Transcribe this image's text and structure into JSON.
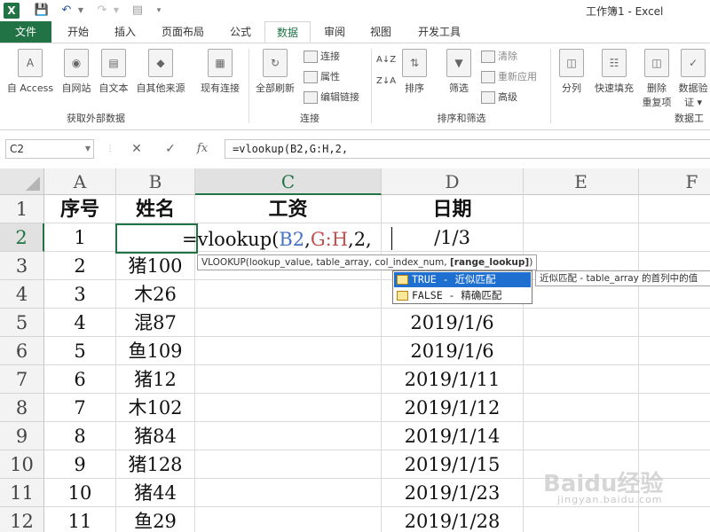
{
  "window": {
    "title": "工作簿1 - Excel"
  },
  "quick_access": {
    "logo": "X",
    "save_icon": "floppy-icon",
    "undo_icon": "undo-icon",
    "redo_icon": "redo-icon",
    "preview_icon": "print-preview-icon"
  },
  "tabs": [
    "文件",
    "开始",
    "插入",
    "页面布局",
    "公式",
    "数据",
    "审阅",
    "视图",
    "开发工具"
  ],
  "active_tab": "数据",
  "ribbon": {
    "get_external": {
      "buttons": [
        "自 Access",
        "自网站",
        "自文本",
        "自其他来源"
      ],
      "group_label": "获取外部数据"
    },
    "existing": "现有连接",
    "refresh_all": "全部刷新",
    "connections": {
      "items": [
        "连接",
        "属性",
        "编辑链接"
      ],
      "group_label": "连接"
    },
    "sort_asc": "A↓Z",
    "sort_desc": "Z↓A",
    "sort": "排序",
    "filter": "筛选",
    "filter_small": [
      "清除",
      "重新应用",
      "高级"
    ],
    "sort_filter_group": "排序和筛选",
    "split": "分列",
    "flash_fill": "快速填充",
    "remove_dup_1": "删除",
    "remove_dup_2": "重复项",
    "validate_1": "数据验",
    "validate_2": "证 ▾",
    "data_tools_group": "数据工"
  },
  "formula_bar": {
    "name_box": "C2",
    "cancel": "✕",
    "enter": "✓",
    "fx": "fx",
    "formula": "=vlookup(B2,G:H,2,"
  },
  "columns": [
    "A",
    "B",
    "C",
    "D",
    "E",
    "F"
  ],
  "rows": [
    {
      "num": "1",
      "a": "序号",
      "b": "姓名",
      "c": "工资",
      "d": "日期"
    },
    {
      "num": "2",
      "a": "1",
      "b": "",
      "c": "",
      "d": "/1/3"
    },
    {
      "num": "3",
      "a": "2",
      "b": "猪100",
      "c": "",
      "d": ""
    },
    {
      "num": "4",
      "a": "3",
      "b": "木26",
      "c": "",
      "d": ""
    },
    {
      "num": "5",
      "a": "4",
      "b": "混87",
      "c": "",
      "d": "2019/1/6"
    },
    {
      "num": "6",
      "a": "5",
      "b": "鱼109",
      "c": "",
      "d": "2019/1/6"
    },
    {
      "num": "7",
      "a": "6",
      "b": "猪12",
      "c": "",
      "d": "2019/1/11"
    },
    {
      "num": "8",
      "a": "7",
      "b": "木102",
      "c": "",
      "d": "2019/1/12"
    },
    {
      "num": "9",
      "a": "8",
      "b": "猪84",
      "c": "",
      "d": "2019/1/14"
    },
    {
      "num": "10",
      "a": "9",
      "b": "猪128",
      "c": "",
      "d": "2019/1/15"
    },
    {
      "num": "11",
      "a": "10",
      "b": "猪44",
      "c": "",
      "d": "2019/1/23"
    },
    {
      "num": "12",
      "a": "11",
      "b": "鱼29",
      "c": "",
      "d": "2019/1/28"
    }
  ],
  "editing": {
    "prefix": "=vlookup(",
    "ref1": "B2",
    "comma1": ",",
    "ref2": "G:H",
    "rest": ",2,"
  },
  "tooltip": {
    "text": "VLOOKUP(lookup_value, table_array, col_index_num, ",
    "bold": "[range_lookup]",
    "close": ")"
  },
  "autocomplete": {
    "items": [
      "TRUE - 近似匹配",
      "FALSE - 精确匹配"
    ],
    "description": "近似匹配 - table_array 的首列中的值"
  },
  "watermark": {
    "main": "Baidu经验",
    "sub": "jingyan.baidu.com"
  },
  "colors": {
    "excel_green": "#217346",
    "ref_blue": "#4472c4",
    "ref_red": "#c0504d",
    "select_blue": "#1f6fd0"
  }
}
